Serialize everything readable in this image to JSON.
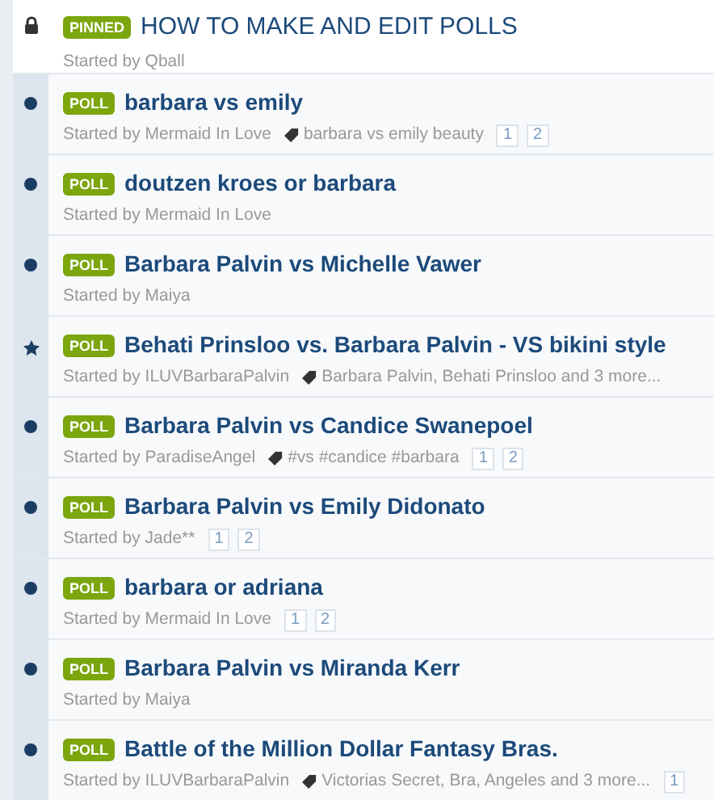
{
  "topics": [
    {
      "kind": "pinned",
      "badge": "PINNED",
      "title": "HOW TO MAKE AND EDIT POLLS",
      "starter": "Started by Qball"
    },
    {
      "kind": "unread",
      "badge": "POLL",
      "title": "barbara vs emily",
      "starter": "Started by Mermaid In Love",
      "tags": "barbara vs emily beauty",
      "pages": [
        "1",
        "2"
      ]
    },
    {
      "kind": "unread",
      "badge": "POLL",
      "title": "doutzen kroes or barbara",
      "starter": "Started by Mermaid In Love"
    },
    {
      "kind": "unread",
      "badge": "POLL",
      "title": "Barbara Palvin vs Michelle Vawer",
      "starter": "Started by Maiya"
    },
    {
      "kind": "starred",
      "badge": "POLL",
      "title": "Behati Prinsloo vs. Barbara Palvin - VS bikini style",
      "starter": "Started by ILUVBarbaraPalvin",
      "tags": "Barbara Palvin, Behati Prinsloo and 3 more..."
    },
    {
      "kind": "unread",
      "badge": "POLL",
      "title": "Barbara Palvin vs Candice Swanepoel",
      "starter": "Started by ParadiseAngel",
      "tags": "#vs #candice #barbara",
      "pages": [
        "1",
        "2"
      ]
    },
    {
      "kind": "unread",
      "badge": "POLL",
      "title": "Barbara Palvin vs Emily Didonato",
      "starter": "Started by Jade**",
      "pages": [
        "1",
        "2"
      ]
    },
    {
      "kind": "unread",
      "badge": "POLL",
      "title": "barbara or adriana",
      "starter": "Started by Mermaid In Love",
      "pages": [
        "1",
        "2"
      ]
    },
    {
      "kind": "unread",
      "badge": "POLL",
      "title": "Barbara Palvin vs Miranda Kerr",
      "starter": "Started by Maiya"
    },
    {
      "kind": "unread",
      "badge": "POLL",
      "title": "Battle of the Million Dollar Fantasy Bras.",
      "starter": "Started by ILUVBarbaraPalvin",
      "tags": "Victorias Secret, Bra, Angeles and 3 more...",
      "pages": [
        "1"
      ]
    }
  ]
}
